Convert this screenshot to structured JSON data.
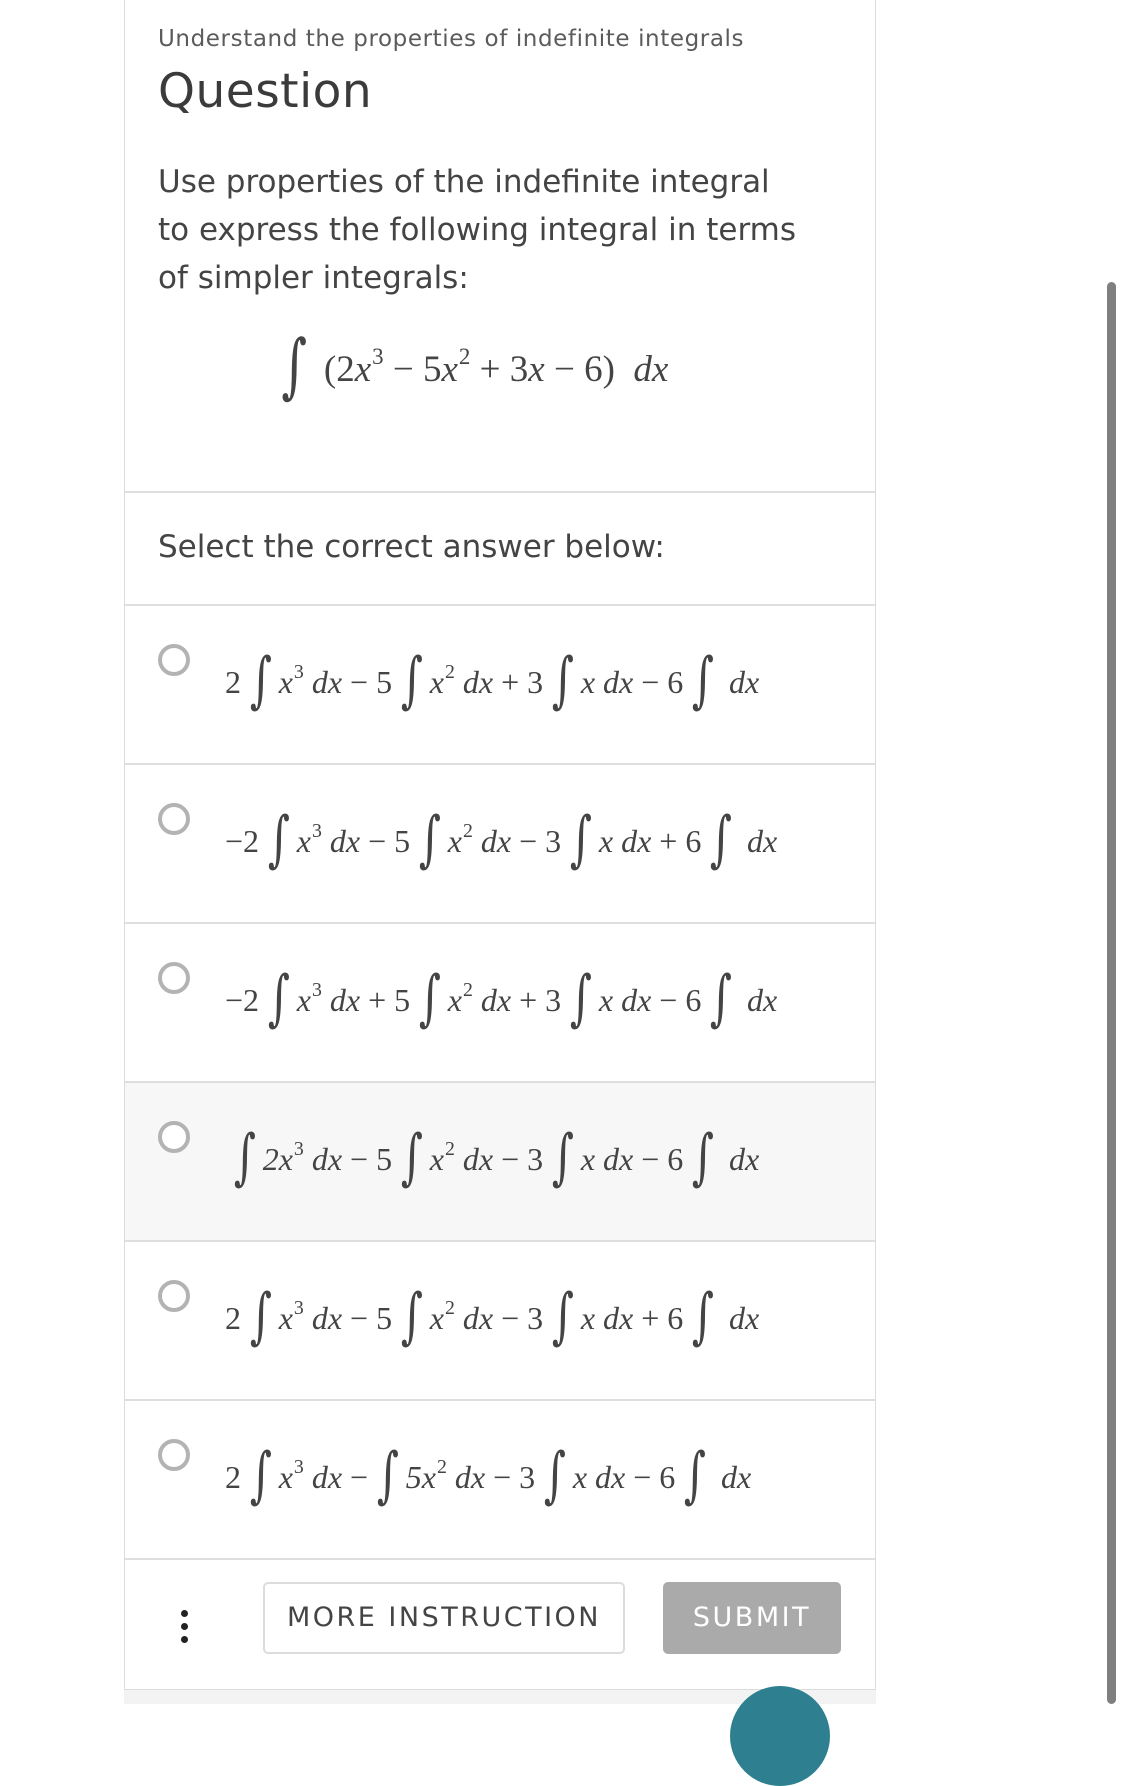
{
  "header": {
    "topic": "Understand the properties of indefinite integrals",
    "title": "Question"
  },
  "question": {
    "prompt": "Use properties of the indefinite integral to express the following integral in terms of simpler integrals:",
    "integrand_parts": [
      "(2",
      "x",
      "3",
      " − 5",
      "x",
      "2",
      " + 3",
      "x",
      " − 6)",
      "dx"
    ]
  },
  "answer_section": {
    "label": "Select the correct answer below:"
  },
  "options": [
    {
      "text": "2 ∫ x^3 dx − 5 ∫ x^2 dx + 3 ∫ x dx − 6 ∫ dx",
      "c1": "2",
      "t1": "x",
      "e1": "3",
      "c2": "− 5",
      "t2": "x",
      "e2": "2",
      "c3": "+ 3",
      "t3": "x",
      "c4": "− 6",
      "selected": false
    },
    {
      "text": "−2 ∫ x^3 dx − 5 ∫ x^2 dx − 3 ∫ x dx + 6 ∫ dx",
      "c1": "−2",
      "t1": "x",
      "e1": "3",
      "c2": "− 5",
      "t2": "x",
      "e2": "2",
      "c3": "− 3",
      "t3": "x",
      "c4": "+ 6",
      "selected": false
    },
    {
      "text": "−2 ∫ x^3 dx + 5 ∫ x^2 dx + 3 ∫ x dx − 6 ∫ dx",
      "c1": "−2",
      "t1": "x",
      "e1": "3",
      "c2": "+ 5",
      "t2": "x",
      "e2": "2",
      "c3": "+ 3",
      "t3": "x",
      "c4": "− 6",
      "selected": false
    },
    {
      "text": "∫ 2x^3 dx − 5 ∫ x^2 dx − 3 ∫ x dx − 6 ∫ dx",
      "c1": "",
      "t1": "2x",
      "e1": "3",
      "c2": "− 5",
      "t2": "x",
      "e2": "2",
      "c3": "− 3",
      "t3": "x",
      "c4": "− 6",
      "selected": false,
      "hovered": true
    },
    {
      "text": "2 ∫ x^3 dx − 5 ∫ x^2 dx − 3 ∫ x dx + 6 ∫ dx",
      "c1": "2",
      "t1": "x",
      "e1": "3",
      "c2": "− 5",
      "t2": "x",
      "e2": "2",
      "c3": "− 3",
      "t3": "x",
      "c4": "+ 6",
      "selected": false
    },
    {
      "text": "2 ∫ x^3 dx − ∫ 5x^2 dx − 3 ∫ x dx − 6 ∫ dx",
      "c1": "2",
      "t1": "x",
      "e1": "3",
      "c2": "−",
      "t2": "5x",
      "e2": "2",
      "c3": "− 3",
      "t3": "x",
      "c4": "− 6",
      "selected": false
    }
  ],
  "math_tokens": {
    "integral": "∫",
    "dx": "dx"
  },
  "footer": {
    "more_label": "MORE INSTRUCTION",
    "submit_label": "SUBMIT",
    "menu_icon": "kebab-menu-icon"
  },
  "colors": {
    "submit_disabled": "#aaaaaa",
    "radio_border": "#b3b3b3",
    "divider": "#dedede",
    "fab": "#2e8090",
    "scrollbar": "#7f7f7f"
  }
}
